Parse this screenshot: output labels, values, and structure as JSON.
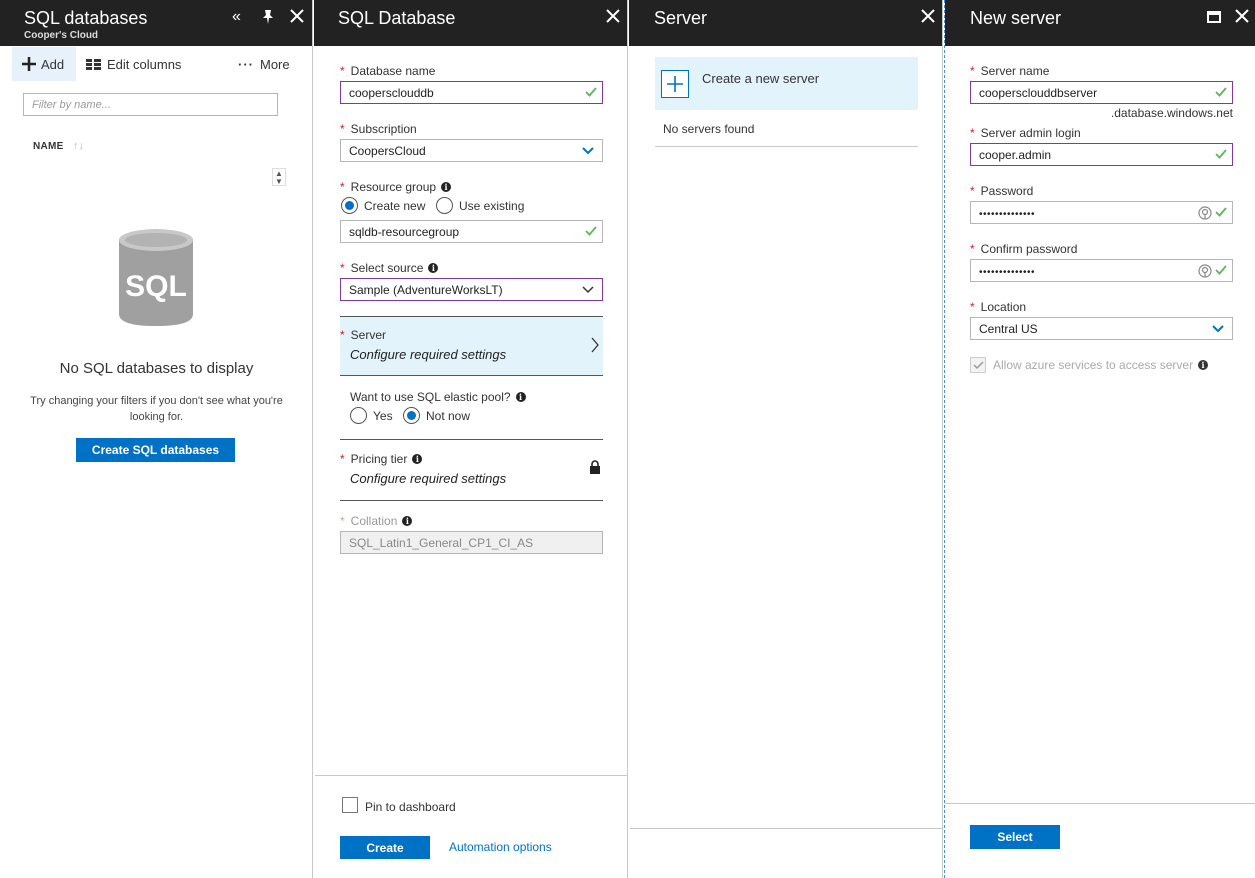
{
  "sqldb": {
    "title": "SQL databases",
    "subtitle": "Cooper's Cloud",
    "toolbar": {
      "add": "Add",
      "edit_columns": "Edit columns",
      "more": "More"
    },
    "filter_placeholder": "Filter by name...",
    "column_name": "NAME",
    "empty_title": "No SQL databases to display",
    "empty_desc": "Try changing your filters if you don't see what you're looking for.",
    "create_button": "Create SQL databases",
    "icon_label": "SQL"
  },
  "sqldatabase": {
    "title": "SQL Database",
    "database_name_label": "Database name",
    "database_name_value": "coopersclouddb",
    "subscription_label": "Subscription",
    "subscription_value": "CoopersCloud",
    "resource_group_label": "Resource group",
    "rg_create_new": "Create new",
    "rg_use_existing": "Use existing",
    "resource_group_value": "sqldb-resourcegroup",
    "select_source_label": "Select source",
    "select_source_value": "Sample (AdventureWorksLT)",
    "server_label": "Server",
    "server_value": "Configure required settings",
    "elastic_pool_label": "Want to use SQL elastic pool?",
    "elastic_yes": "Yes",
    "elastic_no": "Not now",
    "pricing_tier_label": "Pricing tier",
    "pricing_tier_value": "Configure required settings",
    "collation_label": "Collation",
    "collation_value": "SQL_Latin1_General_CP1_CI_AS",
    "pin_label": "Pin to dashboard",
    "create_button": "Create",
    "automation_link": "Automation options"
  },
  "server": {
    "title": "Server",
    "create_new": "Create a new server",
    "no_servers": "No servers found"
  },
  "newserver": {
    "title": "New server",
    "server_name_label": "Server name",
    "server_name_value": "coopersclouddbserver",
    "domain_suffix": ".database.windows.net",
    "admin_login_label": "Server admin login",
    "admin_login_value": "cooper.admin",
    "password_label": "Password",
    "password_value": "••••••••••••••",
    "confirm_password_label": "Confirm password",
    "confirm_password_value": "••••••••••••••",
    "location_label": "Location",
    "location_value": "Central US",
    "allow_azure_label": "Allow azure services to access server",
    "select_button": "Select"
  },
  "colors": {
    "accent": "#0072c6",
    "header": "#222222",
    "valid": "#7e3aa0",
    "check": "#5cb85c",
    "required": "#d62020",
    "highlight": "#e3f3fb"
  }
}
